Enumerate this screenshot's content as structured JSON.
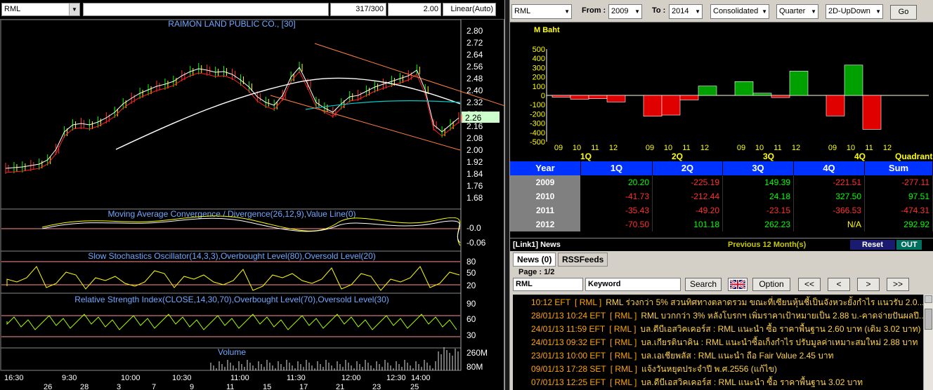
{
  "chart": {
    "symbol": "RML",
    "title": "RAIMON LAND PUBLIC CO., [30]",
    "bar_count": "317/300",
    "step": "2.00",
    "scale": "Linear(Auto)",
    "price_labels": [
      "2.80",
      "2.72",
      "2.64",
      "2.56",
      "2.48",
      "2.40",
      "2.32",
      "2.24",
      "2.16",
      "2.08",
      "2.00",
      "1.92",
      "1.84",
      "1.76",
      "1.68"
    ],
    "last_price": "2.26",
    "macd_label": "Moving Average Convergence / Divergence(26,12,9),Value Line(0)",
    "macd_ticks": [
      "-0.0",
      "-0.06"
    ],
    "stoch_label": "Slow Stochastics Oscillator(14,3,3),Overbought Level(80),Oversold Level(20)",
    "stoch_ticks": [
      "80",
      "50",
      "20"
    ],
    "rsi_label": "Relative Strength Index(CLOSE,14,30,70),Overbought Level(70),Oversold Level(30)",
    "rsi_ticks": [
      "90",
      "60",
      "30"
    ],
    "volume_label": "Volume",
    "volume_ticks": [
      "260M",
      "80M"
    ],
    "time_labels": [
      "16:30",
      "9:30",
      "10:00",
      "10:30",
      "11:00",
      "11:30",
      "12:00",
      "12:30",
      "14:00"
    ],
    "date_labels": [
      "26",
      "28",
      "3",
      "7",
      "9",
      "11",
      "15",
      "17",
      "21",
      "23",
      "25"
    ]
  },
  "filters": {
    "symbol": "RML",
    "from_label": "From :",
    "from_value": "2009",
    "to_label": "To :",
    "to_value": "2014",
    "statement": "Consolidated",
    "period": "Quarter",
    "view": "2D-UpDown",
    "go_label": "Go"
  },
  "chart_data": {
    "type": "bar",
    "ylabel": "M Baht",
    "ylim": [
      -500,
      500
    ],
    "yticks": [
      "500",
      "400",
      "300",
      "200",
      "100",
      "0",
      "-100",
      "-200",
      "-300",
      "-400",
      "-500"
    ],
    "quarter_labels": [
      "1Q",
      "2Q",
      "3Q",
      "4Q"
    ],
    "year_tick_labels": [
      "09",
      "10",
      "11",
      "12"
    ],
    "axis_caption": "Quadrant",
    "series": [
      {
        "quarter": "1Q",
        "values": [
          -20.2,
          -41.73,
          -35.43,
          -70.5
        ]
      },
      {
        "quarter": "2Q",
        "values": [
          -225.19,
          -212.44,
          -49.2,
          101.18
        ]
      },
      {
        "quarter": "3Q",
        "values": [
          149.39,
          24.18,
          -23.15,
          262.23
        ]
      },
      {
        "quarter": "4Q",
        "values": [
          -221.51,
          327.5,
          -366.53,
          null
        ]
      }
    ],
    "positive_color": "#00a000",
    "negative_color": "#e00000"
  },
  "table": {
    "headers": [
      "Year",
      "1Q",
      "2Q",
      "3Q",
      "4Q",
      "Sum"
    ],
    "rows": [
      {
        "year": "2009",
        "cells": [
          "20.20",
          "-225.19",
          "149.39",
          "-221.51",
          "-277.11"
        ],
        "colors": [
          "#00ff00",
          "#ff3030",
          "#00ff00",
          "#ff3030",
          "#ff3030"
        ]
      },
      {
        "year": "2010",
        "cells": [
          "-41.73",
          "-212.44",
          "24.18",
          "327.50",
          "97.51"
        ],
        "colors": [
          "#ff3030",
          "#ff3030",
          "#00ff00",
          "#00ff00",
          "#00ff00"
        ]
      },
      {
        "year": "2011",
        "cells": [
          "-35.43",
          "-49.20",
          "-23.15",
          "-366.53",
          "-474.31"
        ],
        "colors": [
          "#ff3030",
          "#ff3030",
          "#ff3030",
          "#ff3030",
          "#ff3030"
        ]
      },
      {
        "year": "2012",
        "cells": [
          "-70.50",
          "101.18",
          "262.23",
          "N/A",
          "292.92"
        ],
        "colors": [
          "#ff3030",
          "#00ff00",
          "#00ff00",
          "#ffff00",
          "#00ff00"
        ]
      }
    ]
  },
  "news": {
    "title": "[Link1] News",
    "period_note": "Previous 12 Month(s)",
    "reset_label": "Reset",
    "out_label": "OUT",
    "tab_news": "News (0)",
    "tab_rss": "RSSFeeds",
    "page_label": "Page : 1/2",
    "symbol_value": "RML",
    "keyword_value": "Keyword",
    "search_label": "Search",
    "option_label": "Option",
    "nav_first": "<<",
    "nav_prev": "<",
    "nav_next": ">",
    "nav_last": ">>",
    "items": [
      {
        "time": "10:12  EFT",
        "sym": "[ RML ]",
        "title": "RML ร่วงกว่า 5% สวนทิศทางตลาดรวม ขณะที่เซียนหุ้นชี้เป็นจังหวะยั้งกำไร แนวรับ 2.0..."
      },
      {
        "time": "28/01/13 10:24  EFT",
        "sym": "[ RML ]",
        "title": "RML บวกกว่า 3% หลังโบรกฯ เพิ่มราคาเป้าหมายเป็น 2.88 บ.-คาดจ่ายปันผลปี..."
      },
      {
        "time": "24/01/13 11:59  EFT",
        "sym": "[ RML ]",
        "title": "บล.ดีบีเอสวิคเคอร์ส : RML แนะนำ ซื้อ ราคาพื้นฐาน 2.60 บาท (เดิม 3.02 บาท)"
      },
      {
        "time": "24/01/13 09:32  EFT",
        "sym": "[ RML ]",
        "title": "บล.เกียรตินาคิน : RML แนะนำซื้อเก็งกำไร ปรับมูลค่าเหมาะสมใหม่ 2.88 บาท"
      },
      {
        "time": "23/01/13 10:00  EFT",
        "sym": "[ RML ]",
        "title": "บล.เอเชียพลัส : RML แนะนำ ถือ Fair Value 2.45 บาท"
      },
      {
        "time": "09/01/13 17:28  SET",
        "sym": "[ RML ]",
        "title": "แจ้งวันหยุดประจำปี พ.ศ.2556 (แก้ไข)"
      },
      {
        "time": "07/01/13 12:25  EFT",
        "sym": "[ RML ]",
        "title": "บล.ดีบีเอสวิคเคอร์ส : RML แนะนำ ซื้อ ราคาพื้นฐาน 3.02 บาท"
      }
    ]
  }
}
